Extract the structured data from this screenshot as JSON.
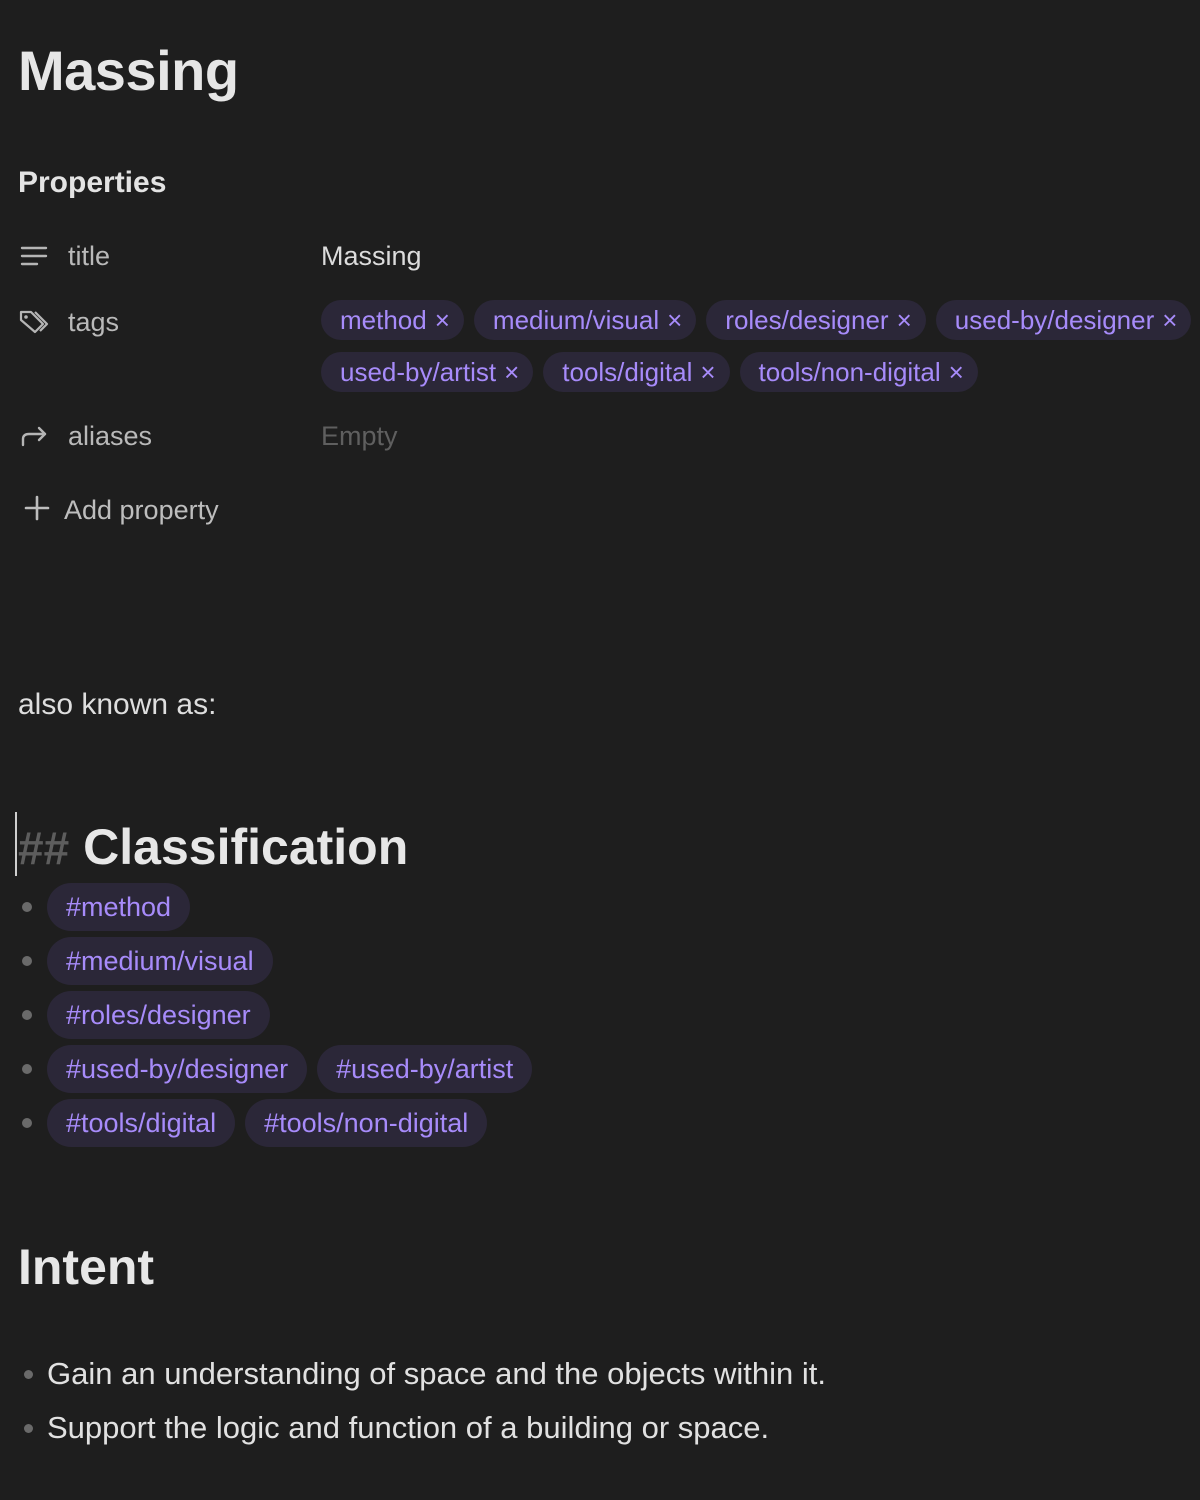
{
  "note": {
    "title": "Massing"
  },
  "properties": {
    "heading": "Properties",
    "title": {
      "key": "title",
      "icon": "text-lines-icon",
      "value": "Massing"
    },
    "tags": {
      "key": "tags",
      "icon": "tags-icon",
      "remove_glyph": "×",
      "values": [
        "method",
        "medium/visual",
        "roles/designer",
        "used-by/designer",
        "used-by/artist",
        "tools/digital",
        "tools/non-digital"
      ]
    },
    "aliases": {
      "key": "aliases",
      "icon": "forward-arrow-icon",
      "placeholder": "Empty"
    },
    "add_property": {
      "icon": "plus-icon",
      "label": "Add property"
    }
  },
  "body": {
    "aka": "also known as:",
    "classification": {
      "marker": "##",
      "heading": "Classification",
      "rows": [
        [
          "#method"
        ],
        [
          "#medium/visual"
        ],
        [
          "#roles/designer"
        ],
        [
          "#used-by/designer",
          "#used-by/artist"
        ],
        [
          "#tools/digital",
          "#tools/non-digital"
        ]
      ]
    },
    "intent": {
      "heading": "Intent",
      "items": [
        "Gain an understanding of space and the objects within it.",
        "Support the logic and function of a building or space."
      ]
    }
  },
  "colors": {
    "background": "#1e1e1e",
    "tag_text": "#a78bfa",
    "tag_background": "#2b2738",
    "muted": "#5f5f5f"
  }
}
